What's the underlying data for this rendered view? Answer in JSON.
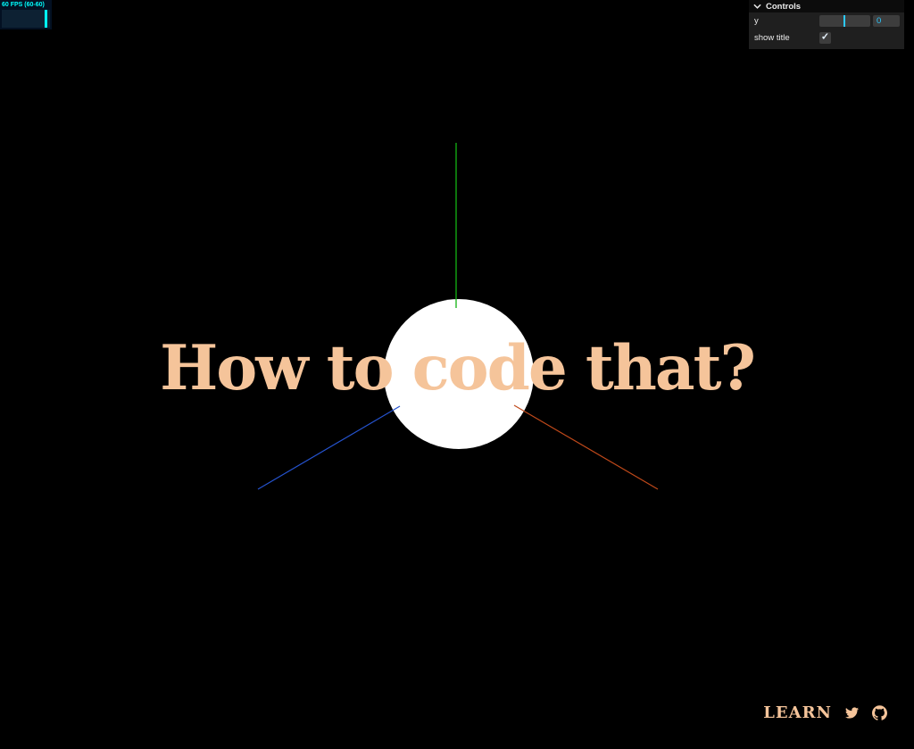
{
  "stats": {
    "fps_text": "60 FPS (60-60)",
    "fg_color": "#00ffff",
    "bg_color": "#031022",
    "graph_color": "#0d2133"
  },
  "gui": {
    "title": "Controls",
    "y": {
      "label": "y",
      "value": "0"
    },
    "show_title": {
      "label": "show title",
      "checked": true,
      "checkmark": "✓"
    },
    "accent_color": "#2cc9ff"
  },
  "scene": {
    "title": "How to code that?",
    "title_color": "#f5c49a",
    "sphere_color": "#ffffff",
    "axis_colors": {
      "x": "#c0491a",
      "y": "#12b212",
      "z": "#2553cf"
    }
  },
  "footer": {
    "learn_label": "LEARN",
    "color": "#f5c49a",
    "icons": [
      {
        "name": "twitter"
      },
      {
        "name": "github"
      }
    ]
  }
}
